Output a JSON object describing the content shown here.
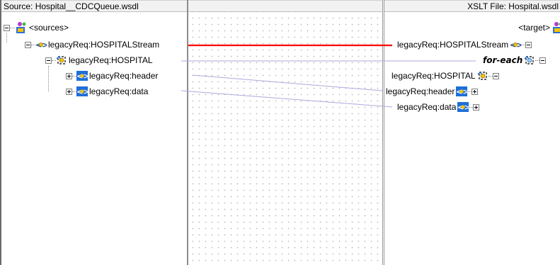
{
  "source_panel": {
    "header": "Source: Hospital__CDCQueue.wsdl",
    "nodes": [
      {
        "label": "<sources>",
        "icon": "root-schema-icon"
      },
      {
        "label": "legacyReq:HOSPITALStream",
        "icon": "element-icon"
      },
      {
        "label": "legacyReq:HOSPITAL",
        "icon": "repeating-element-icon"
      },
      {
        "label": "legacyReq:header",
        "icon": "element-icon"
      },
      {
        "label": "legacyReq:data",
        "icon": "element-icon"
      }
    ]
  },
  "target_panel": {
    "header": "XSLT File: Hospital.wsdl",
    "nodes": [
      {
        "label": "<target>",
        "icon": "root-schema-icon"
      },
      {
        "label": "legacyReq:HOSPITALStream",
        "icon": "element-icon"
      },
      {
        "label": "for-each",
        "icon": "for-each-icon"
      },
      {
        "label": "legacyReq:HOSPITAL",
        "icon": "repeating-element-icon"
      },
      {
        "label": "legacyReq:header",
        "icon": "element-icon"
      },
      {
        "label": "legacyReq:data",
        "icon": "element-icon"
      }
    ]
  },
  "colors": {
    "selected_link": "#ff0000",
    "link": "#aaaadd",
    "element_icon_blue": "#1e6fd9",
    "element_icon_yellow": "#f5c400"
  }
}
